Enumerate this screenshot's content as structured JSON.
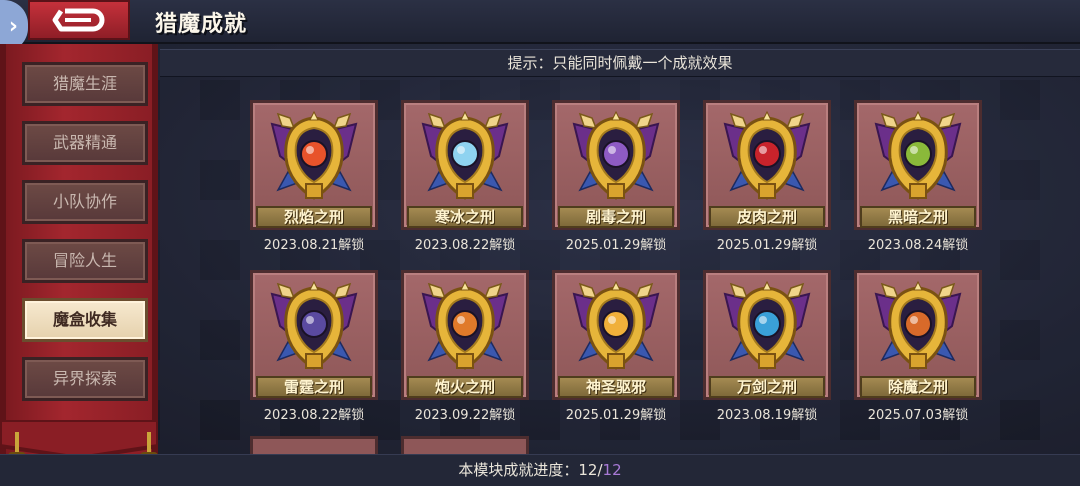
{
  "header": {
    "title": "猎魔成就",
    "expand_glyph": "›",
    "back_icon": "back-arrow-icon"
  },
  "hint": "提示：只能同时佩戴一个成就效果",
  "sidebar": {
    "items": [
      {
        "label": "猎魔生涯",
        "active": false
      },
      {
        "label": "武器精通",
        "active": false
      },
      {
        "label": "小队协作",
        "active": false
      },
      {
        "label": "冒险人生",
        "active": false
      },
      {
        "label": "魔盒收集",
        "active": true
      },
      {
        "label": "异界探索",
        "active": false
      }
    ]
  },
  "achievements": [
    {
      "name": "烈焰之刑",
      "date": "2023.08.21解锁",
      "gem_color": "#e8532b"
    },
    {
      "name": "寒冰之刑",
      "date": "2023.08.22解锁",
      "gem_color": "#8fd3f0"
    },
    {
      "name": "剧毒之刑",
      "date": "2025.01.29解锁",
      "gem_color": "#8e5bc4"
    },
    {
      "name": "皮肉之刑",
      "date": "2025.01.29解锁",
      "gem_color": "#c9232b"
    },
    {
      "name": "黑暗之刑",
      "date": "2023.08.24解锁",
      "gem_color": "#8ab93a"
    },
    {
      "name": "雷霆之刑",
      "date": "2023.08.22解锁",
      "gem_color": "#5a4aa0"
    },
    {
      "name": "炮火之刑",
      "date": "2023.09.22解锁",
      "gem_color": "#e07a2a"
    },
    {
      "name": "神圣驱邪",
      "date": "2025.01.29解锁",
      "gem_color": "#f0b03a"
    },
    {
      "name": "万剑之刑",
      "date": "2023.08.19解锁",
      "gem_color": "#3aa0d8"
    },
    {
      "name": "除魔之刑",
      "date": "2025.07.03解锁",
      "gem_color": "#d86a2a"
    }
  ],
  "progress": {
    "label": "本模块成就进度：",
    "current": "12",
    "separator": "/",
    "total": "12"
  },
  "colors": {
    "banner_red": "#a3262e",
    "card_bg": "#8e5758",
    "gold": "#c9a53a",
    "total_purple": "#a87ad6"
  }
}
